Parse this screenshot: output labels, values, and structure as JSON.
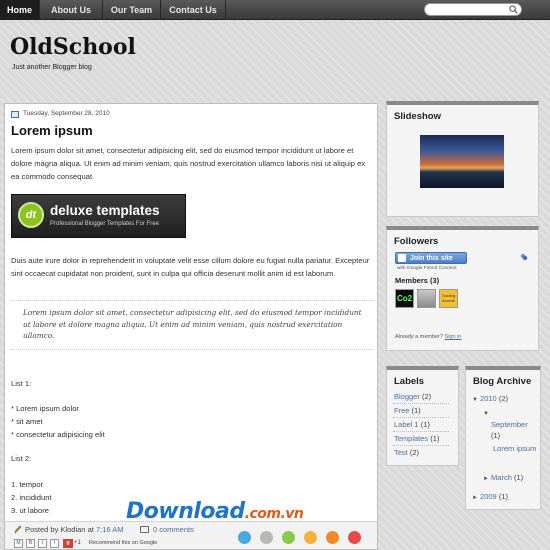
{
  "nav": {
    "items": [
      "Home",
      "About Us",
      "Our Team",
      "Contact Us"
    ],
    "search_placeholder": ""
  },
  "header": {
    "title": "OldSchool",
    "description": "Just another Blogger blog"
  },
  "post": {
    "date": "Tuesday, September 28, 2010",
    "title": "Lorem ipsum",
    "para1": "Lorem ipsum dolor sit amet, consectetur adipisicing elit, sed do eiusmod tempor incididunt ut labore et dolore magna aliqua. Ut enim ad minim veniam, quis nostrud exercitation ullamco laboris nisi ut aliquip ex ea commodo consequat.",
    "banner_title": "deluxe templates",
    "banner_sub": "Professional Blogger Templates For Free",
    "para2": "Duis aute irure dolor in reprehenderit in voluptate velit esse cillum dolore eu fugiat nulla pariatur. Excepteur sint occaecat cupidatat non proident, sunt in culpa qui officia deserunt mollit anim id est laborum.",
    "quote": "Lorem ipsum dolor sit amet, consectetur adipisicing elit, sed do eiusmod tempor incididunt ut labore et dolore magna aliqua. Ut enim ad minim veniam, quis nostrud exercitation ullamco.",
    "list1_title": "List 1:",
    "list1": [
      "* Lorem ipsum dolor",
      "* sit amet",
      "* consectetur adipisicing elit"
    ],
    "list2_title": "List 2:",
    "list2": [
      "1. tempor",
      "2. incididunt",
      "3. ut labore"
    ],
    "footer": {
      "posted_by": "Posted by",
      "author": "Klodian",
      "at": "at",
      "time": "7:16 AM",
      "comments": "0 comments",
      "share_labels": [
        "M",
        "B",
        "t",
        "f"
      ],
      "gplus": "g",
      "plusone": "+1",
      "recommend": "Recommend this on Google"
    },
    "dot_colors": [
      "#4aa8e0",
      "#b8b8b8",
      "#8cc84b",
      "#f4b23c",
      "#f08a2a",
      "#e54b4b"
    ]
  },
  "sidebar": {
    "slideshow": {
      "title": "Slideshow"
    },
    "followers": {
      "title": "Followers",
      "join": "Join this site",
      "gfc": "with Google Friend Connect",
      "members": "Members (3)",
      "already": "Already a member?",
      "sign_in": "Sign in"
    },
    "labels": {
      "title": "Labels",
      "items": [
        {
          "name": "Blogger",
          "count": "(2)"
        },
        {
          "name": "Free",
          "count": "(1)"
        },
        {
          "name": "Label 1",
          "count": "(1)"
        },
        {
          "name": "Templates",
          "count": "(1)"
        },
        {
          "name": "Test",
          "count": "(2)"
        }
      ]
    },
    "archive": {
      "title": "Blog Archive",
      "y2010": "2010",
      "y2010_count": "(2)",
      "september": "September",
      "september_count": "(1)",
      "post": "Lorem ipsum",
      "march": "March",
      "march_count": "(1)",
      "y2009": "2009",
      "y2009_count": "(1)"
    }
  },
  "watermark": {
    "text": "Download",
    "ext": ".com.vn"
  }
}
